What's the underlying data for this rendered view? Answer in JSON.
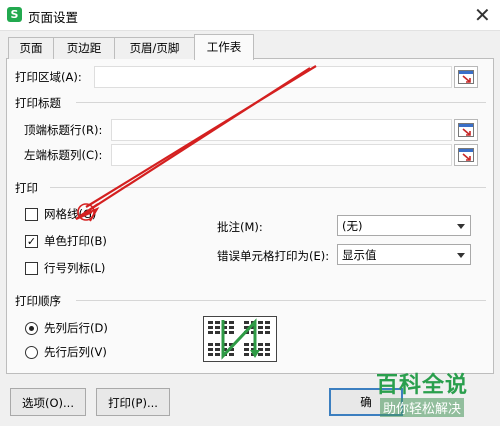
{
  "window": {
    "app_icon_letter": "S",
    "title": "页面设置",
    "close_symbol": "✕"
  },
  "tabs": [
    {
      "label": "页面",
      "active": false
    },
    {
      "label": "页边距",
      "active": false
    },
    {
      "label": "页眉/页脚",
      "active": false
    },
    {
      "label": "工作表",
      "active": true
    }
  ],
  "print_area": {
    "label": "打印区域(A):",
    "value": ""
  },
  "print_titles": {
    "section_title": "打印标题",
    "top_rows_label": "顶端标题行(R):",
    "top_rows_value": "",
    "left_cols_label": "左端标题列(C):",
    "left_cols_value": ""
  },
  "print": {
    "section_title": "打印",
    "gridlines": {
      "label": "网格线(G)",
      "checked": false
    },
    "monochrome": {
      "label": "单色打印(B)",
      "checked": true
    },
    "row_col_headers": {
      "label": "行号列标(L)",
      "checked": false
    },
    "comments": {
      "label": "批注(M):",
      "value": "(无)"
    },
    "cell_errors": {
      "label": "错误单元格打印为(E):",
      "value": "显示值"
    },
    "check_mark": "✓"
  },
  "page_order": {
    "section_title": "打印顺序",
    "down_then_over": {
      "label": "先列后行(D)",
      "selected": true
    },
    "over_then_down": {
      "label": "先行后列(V)",
      "selected": false
    }
  },
  "buttons": {
    "options": "选项(O)...",
    "print": "打印(P)...",
    "ok": "确"
  },
  "watermark": {
    "main": "百科全说",
    "sub": "助你轻松解决"
  },
  "colors": {
    "annotation_arrow": "#d42020",
    "order_arrow": "#2e9b45",
    "brand": "#22a94f"
  }
}
